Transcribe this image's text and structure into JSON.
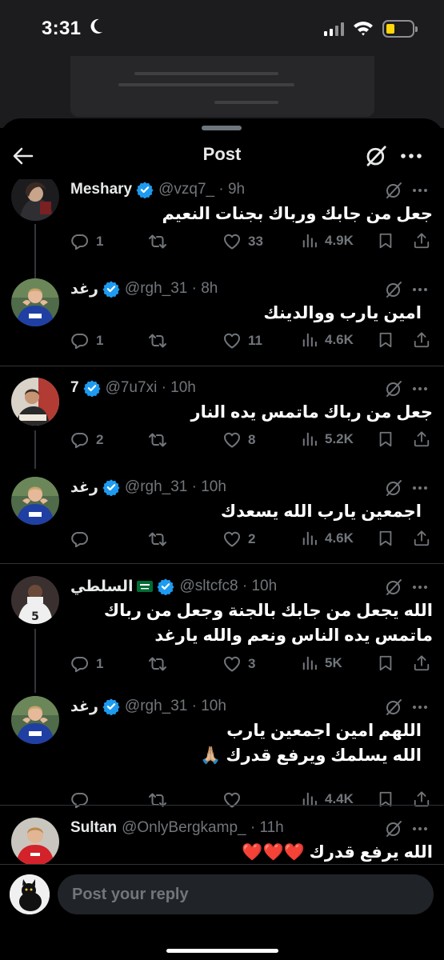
{
  "status_bar": {
    "time": "3:31"
  },
  "header": {
    "title": "Post"
  },
  "tweets": [
    {
      "name": "Meshary",
      "handle": "@vzq7_ · 9h",
      "text": "جعل من جابك ورباك بجنات النعيم",
      "replies": "1",
      "retweets": "",
      "likes": "33",
      "views": "4.9K"
    },
    {
      "name": "رغد",
      "handle": "@rgh_31 · 8h",
      "text": "امين يارب ووالدينك",
      "replies": "1",
      "retweets": "",
      "likes": "11",
      "views": "4.6K"
    },
    {
      "name": "7",
      "handle": "@7u7xi · 10h",
      "text": "جعل من رباك ماتمس يده النار",
      "replies": "2",
      "retweets": "",
      "likes": "8",
      "views": "5.2K"
    },
    {
      "name": "رغد",
      "handle": "@rgh_31 · 10h",
      "text": "اجمعين يارب الله يسعدك",
      "replies": "",
      "retweets": "",
      "likes": "2",
      "views": "4.6K"
    },
    {
      "name": "السلطي",
      "handle": "@sltcfc8 · 10h",
      "text": "الله يجعل من جابك بالجنة وجعل من رباك ماتمس يده الناس ونعم والله يارغد",
      "replies": "1",
      "retweets": "",
      "likes": "3",
      "views": "5K"
    },
    {
      "name": "رغد",
      "handle": "@rgh_31 · 10h",
      "text": "اللهم امين اجمعين يارب\nالله يسلمك ويرفع قدرك 🙏🏼",
      "replies": "",
      "retweets": "",
      "likes": "",
      "views": "4.4K"
    },
    {
      "name": "Sultan",
      "handle": "@OnlyBergkamp_ · 11h",
      "text": "الله يرفع قدرك ❤️❤️❤️"
    }
  ],
  "composer": {
    "placeholder": "Post your reply"
  },
  "colors": {
    "background": "#000000",
    "text": "#e7e9ea",
    "muted": "#71767b",
    "verified": "#1d9bf0",
    "divider": "#2f3336",
    "battery": "#ffd60a"
  },
  "icons": [
    "back-arrow-icon",
    "grok-icon",
    "more-icon",
    "verified-badge-icon",
    "reply-icon",
    "retweet-icon",
    "like-icon",
    "views-icon",
    "bookmark-icon",
    "share-icon",
    "saudi-flag-icon",
    "moon-icon",
    "signal-icon",
    "wifi-icon",
    "battery-icon"
  ]
}
